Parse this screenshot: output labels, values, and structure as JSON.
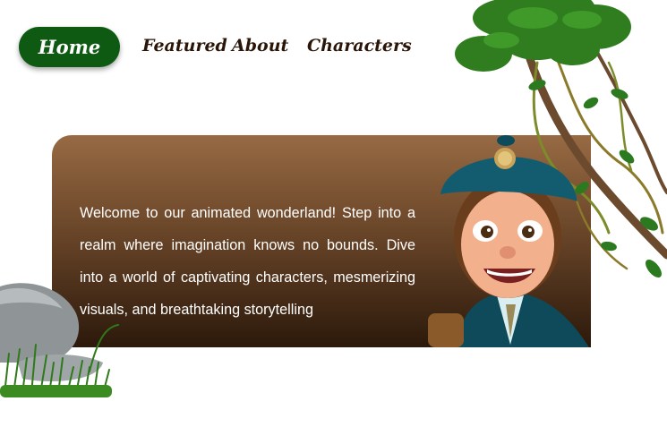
{
  "nav": {
    "home": "Home",
    "featured": "Featured",
    "about": "About",
    "characters": "Characters"
  },
  "hero": {
    "text": "Welcome to our animated wonderland! Step into a realm where imagination knows no bounds. Dive into a world of captivating characters, mesmerizing visuals, and breathtaking storytelling"
  },
  "colors": {
    "nav_active": "#0e5a12",
    "nav_text": "#2a1608",
    "hero_top": "#976a43",
    "hero_bottom": "#2c190b"
  },
  "images": {
    "hero_character": "cartoon-boy-in-blue-uniform-and-cap",
    "decor_top_right": "jungle-vines-and-leaves",
    "decor_bottom_left": "grey-rock-with-grass"
  }
}
